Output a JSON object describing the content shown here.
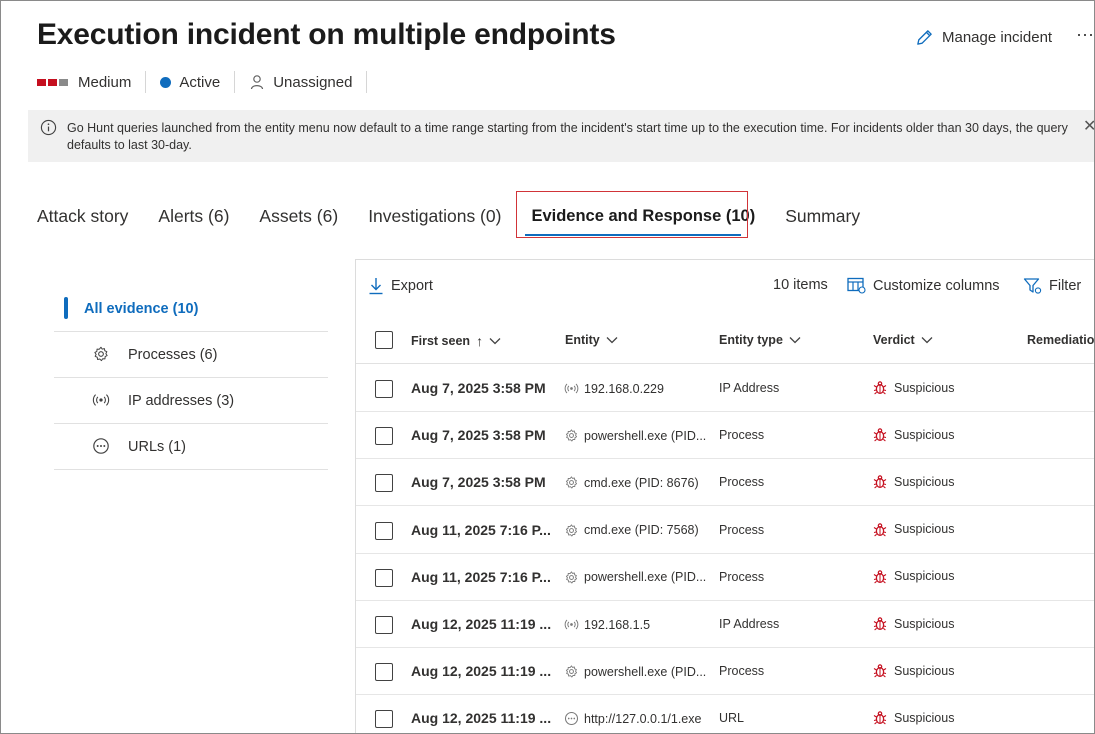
{
  "header": {
    "title": "Execution incident on multiple endpoints",
    "manage_label": "Manage incident",
    "more_label": "⋯",
    "severity": {
      "label": "Medium",
      "colors": [
        "#c50f1f",
        "#c50f1f",
        "#8a8a8a"
      ]
    },
    "status": {
      "label": "Active",
      "color": "#0f6cbd"
    },
    "assignee": "Unassigned"
  },
  "banner": {
    "text": "Go Hunt queries launched from the entity menu now default to a time range starting from the incident's start time up to the execution time. For incidents older than 30 days, the query defaults to last 30-day.",
    "close": "✕"
  },
  "tabs": [
    {
      "label": "Attack story"
    },
    {
      "label": "Alerts (6)"
    },
    {
      "label": "Assets (6)"
    },
    {
      "label": "Investigations (0)"
    },
    {
      "label": "Evidence and Response (10)",
      "active": true
    },
    {
      "label": "Summary"
    }
  ],
  "left_nav": [
    {
      "label": "All evidence (10)",
      "active": true
    },
    {
      "label": "Processes (6)",
      "icon": "gear-icon"
    },
    {
      "label": "IP addresses (3)",
      "icon": "broadcast-icon"
    },
    {
      "label": "URLs (1)",
      "icon": "url-icon"
    }
  ],
  "toolbar": {
    "export": "Export",
    "count": "10 items",
    "customize": "Customize columns",
    "filter": "Filter"
  },
  "columns": {
    "first_seen": "First seen",
    "entity": "Entity",
    "entity_type": "Entity type",
    "verdict": "Verdict",
    "remediation": "Remediatio"
  },
  "rows": [
    {
      "date": "Aug 7, 2025 3:58 PM",
      "entity": "192.168.0.229",
      "icon": "broadcast-icon",
      "type": "IP Address",
      "verdict": "Suspicious"
    },
    {
      "date": "Aug 7, 2025 3:58 PM",
      "entity": "powershell.exe (PID...",
      "icon": "gear-icon",
      "type": "Process",
      "verdict": "Suspicious"
    },
    {
      "date": "Aug 7, 2025 3:58 PM",
      "entity": "cmd.exe (PID: 8676)",
      "icon": "gear-icon",
      "type": "Process",
      "verdict": "Suspicious"
    },
    {
      "date": "Aug 11, 2025 7:16 P...",
      "entity": "cmd.exe (PID: 7568)",
      "icon": "gear-icon",
      "type": "Process",
      "verdict": "Suspicious"
    },
    {
      "date": "Aug 11, 2025 7:16 P...",
      "entity": "powershell.exe (PID...",
      "icon": "gear-icon",
      "type": "Process",
      "verdict": "Suspicious"
    },
    {
      "date": "Aug 12, 2025 11:19 ...",
      "entity": "192.168.1.5",
      "icon": "broadcast-icon",
      "type": "IP Address",
      "verdict": "Suspicious"
    },
    {
      "date": "Aug 12, 2025 11:19 ...",
      "entity": "powershell.exe (PID...",
      "icon": "gear-icon",
      "type": "Process",
      "verdict": "Suspicious"
    },
    {
      "date": "Aug 12, 2025 11:19 ...",
      "entity": "http://127.0.0.1/1.exe",
      "icon": "url-icon",
      "type": "URL",
      "verdict": "Suspicious"
    }
  ],
  "colors": {
    "accent": "#0f6cbd",
    "danger": "#c50f1f",
    "highlight_border": "#d13438"
  }
}
